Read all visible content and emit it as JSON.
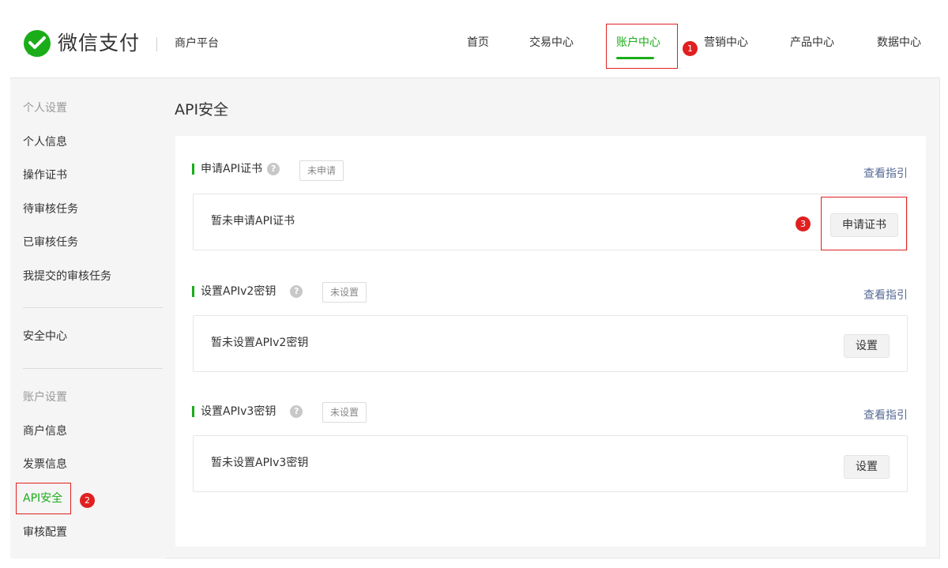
{
  "header": {
    "brand": "微信支付",
    "platform": "商户平台",
    "nav": [
      {
        "label": "首页"
      },
      {
        "label": "交易中心"
      },
      {
        "label": "账户中心"
      },
      {
        "label": "营销中心"
      },
      {
        "label": "产品中心"
      },
      {
        "label": "数据中心"
      }
    ],
    "active_nav": "账户中心"
  },
  "annotations": {
    "badge1": "1",
    "badge2": "2",
    "badge3": "3"
  },
  "sidebar": {
    "personal_heading": "个人设置",
    "personal_items": [
      {
        "label": "个人信息"
      },
      {
        "label": "操作证书"
      },
      {
        "label": "待审核任务"
      },
      {
        "label": "已审核任务"
      },
      {
        "label": "我提交的审核任务"
      }
    ],
    "security_center": "安全中心",
    "account_heading": "账户设置",
    "account_items": [
      {
        "label": "商户信息"
      },
      {
        "label": "发票信息"
      },
      {
        "label": "API安全"
      },
      {
        "label": "审核配置"
      }
    ],
    "active_item": "API安全"
  },
  "main": {
    "title": "API安全",
    "sections": [
      {
        "title": "申请API证书",
        "status": "未申请",
        "guide": "查看指引",
        "empty_text": "暂未申请API证书",
        "button": "申请证书"
      },
      {
        "title": "设置APIv2密钥",
        "status": "未设置",
        "guide": "查看指引",
        "empty_text": "暂未设置APIv2密钥",
        "button": "设置"
      },
      {
        "title": "设置APIv3密钥",
        "status": "未设置",
        "guide": "查看指引",
        "empty_text": "暂未设置APIv3密钥",
        "button": "设置"
      }
    ]
  },
  "colors": {
    "accent": "#1aad19",
    "annotation": "#e02020",
    "link": "#576b95"
  },
  "icons": {
    "logo": "wechat-pay-logo",
    "help": "question-circle-icon"
  }
}
